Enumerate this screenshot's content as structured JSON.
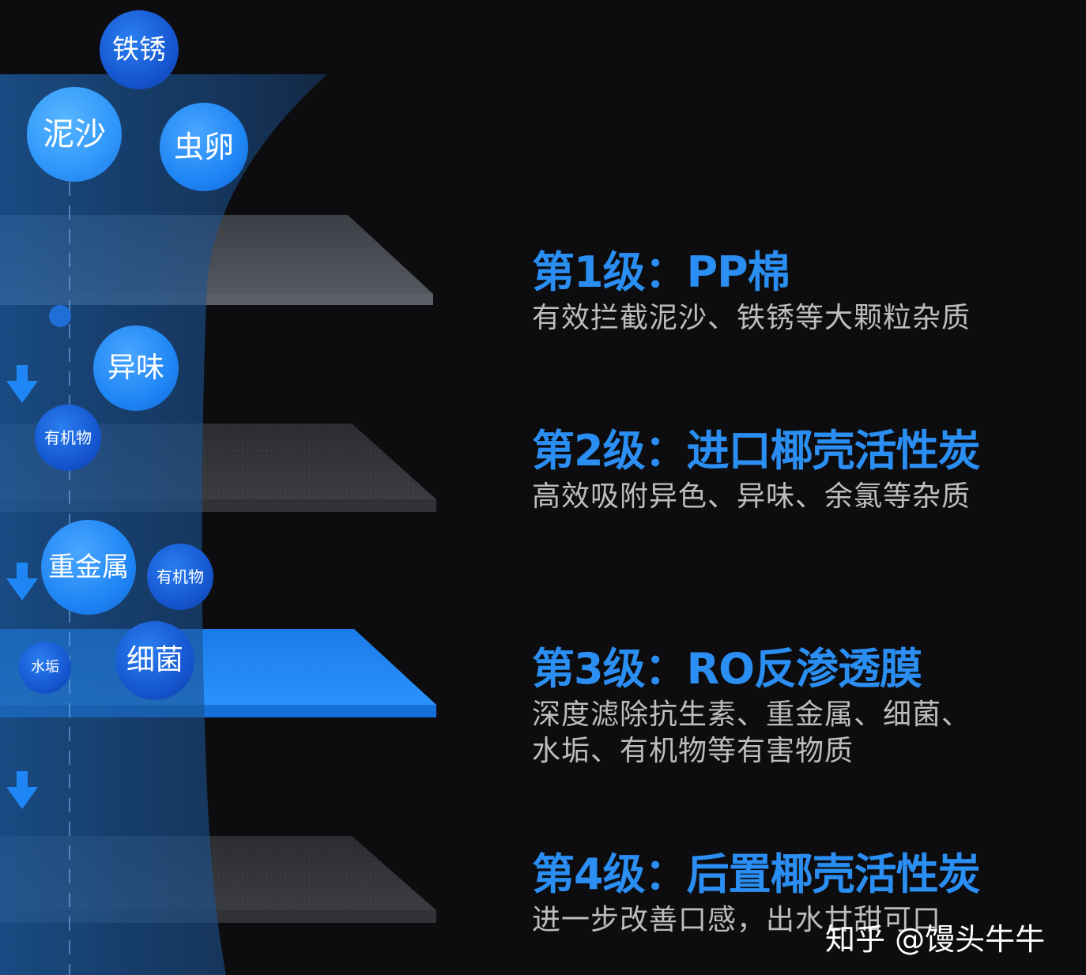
{
  "bubbles": {
    "rust": "铁锈",
    "silt": "泥沙",
    "eggs": "虫卵",
    "odor": "异味",
    "organic_1": "有机物",
    "heavy_metal": "重金属",
    "organic_2": "有机物",
    "scale": "水垢",
    "bacteria": "细菌"
  },
  "stages": [
    {
      "title": "第1级：PP棉",
      "desc": "有效拦截泥沙、铁锈等大颗粒杂质"
    },
    {
      "title": "第2级：进口椰壳活性炭",
      "desc": "高效吸附异色、异味、余氯等杂质"
    },
    {
      "title": "第3级：RO反渗透膜",
      "desc": "深度滤除抗生素、重金属、细菌、",
      "desc2": "水垢、有机物等有害物质"
    },
    {
      "title": "第4级：后置椰壳活性炭",
      "desc": "进一步改善口感，出水甘甜可口"
    }
  ],
  "watermark": "知乎 @馒头牛牛",
  "colors": {
    "background": "#0d0d10",
    "title_blue": "#2a8ef3",
    "desc_gray": "#bdbdbd",
    "ro_layer": "#1f86f5",
    "filter_gray": "#4a4a4a"
  }
}
